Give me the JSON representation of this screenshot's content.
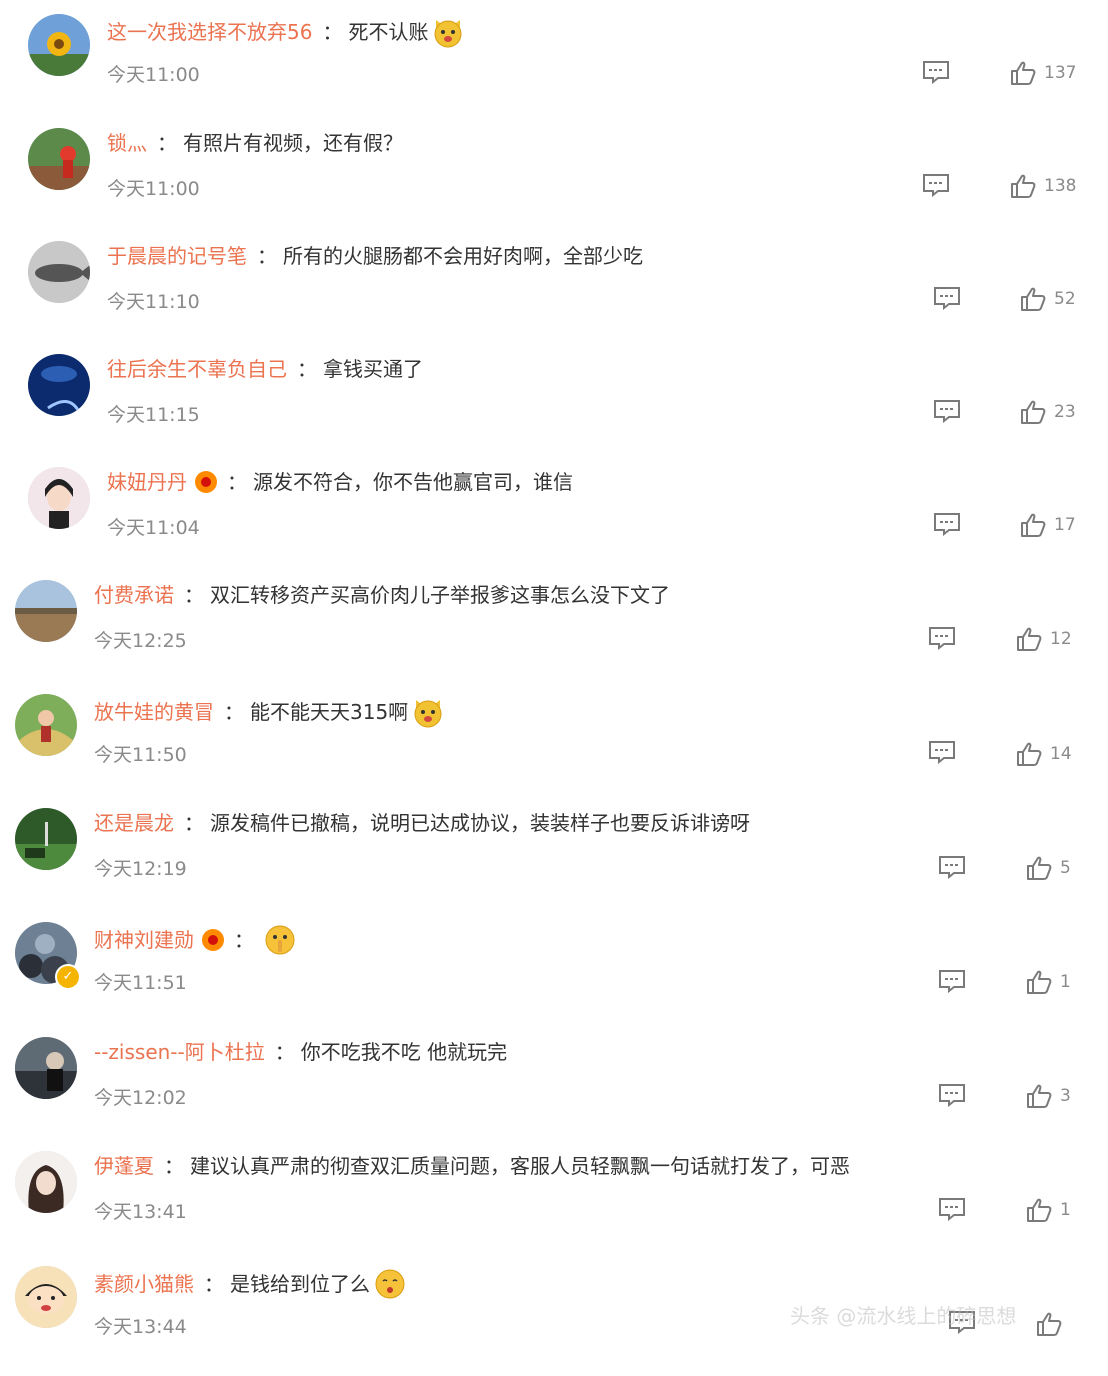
{
  "comments": [
    {
      "user": "这一次我选择不放弃56",
      "sep": "：",
      "text": "死不认账",
      "emoji": "cat-face-emoji",
      "time": "今天11:00",
      "likes": "137"
    },
    {
      "user": "锁灬",
      "sep": "：",
      "text": "有照片有视频，还有假？",
      "time": "今天11:00",
      "likes": "138"
    },
    {
      "user": "于晨晨的记号笔",
      "sep": "：",
      "text": "所有的火腿肠都不会用好肉啊，全部少吃",
      "time": "今天11:10",
      "likes": "52"
    },
    {
      "user": "往后余生不辜负自己",
      "sep": "：",
      "text": "拿钱买通了",
      "time": "今天11:15",
      "likes": "23"
    },
    {
      "user": "妹妞丹丹",
      "badge": "fan-badge-icon",
      "sep": "：",
      "text": "源发不符合，你不告他赢官司，谁信",
      "time": "今天11:04",
      "likes": "17"
    },
    {
      "user": "付费承诺",
      "sep": "：",
      "text": "双汇转移资产买高价肉儿子举报爹这事怎么没下文了",
      "time": "今天12:25",
      "likes": "12"
    },
    {
      "user": "放牛娃的黄冒",
      "sep": "：",
      "text": "能不能天天315啊",
      "emoji": "cat-face-emoji",
      "time": "今天11:50",
      "likes": "14"
    },
    {
      "user": "还是晨龙",
      "sep": "：",
      "text": "源发稿件已撤稿，说明已达成协议，装装样子也要反诉诽谤呀",
      "time": "今天12:19",
      "likes": "5"
    },
    {
      "user": "财神刘建勋",
      "badge": "fan-badge-icon",
      "sep": "：",
      "text": "",
      "emoji": "shush-face-emoji",
      "time": "今天11:51",
      "likes": "1"
    },
    {
      "user": "--zissen--阿卜杜拉",
      "sep": "：",
      "text": "你不吃我不吃 他就玩完",
      "time": "今天12:02",
      "likes": "3"
    },
    {
      "user": "伊蓬夏",
      "sep": "：",
      "text": "建议认真严肃的彻查双汇质量问题，客服人员轻飘飘一句话就打发了，可恶",
      "time": "今天13:41",
      "likes": "1"
    },
    {
      "user": "素颜小猫熊",
      "sep": "：",
      "text": "是钱给到位了么",
      "emoji": "kiss-face-emoji",
      "time": "今天13:44",
      "likes": ""
    }
  ],
  "watermark": "头条 @流水线上的碎思想",
  "colors": {
    "username": "#eb7350",
    "text": "#333333",
    "meta": "#8a8a8a",
    "icon": "#7a7a7a"
  }
}
